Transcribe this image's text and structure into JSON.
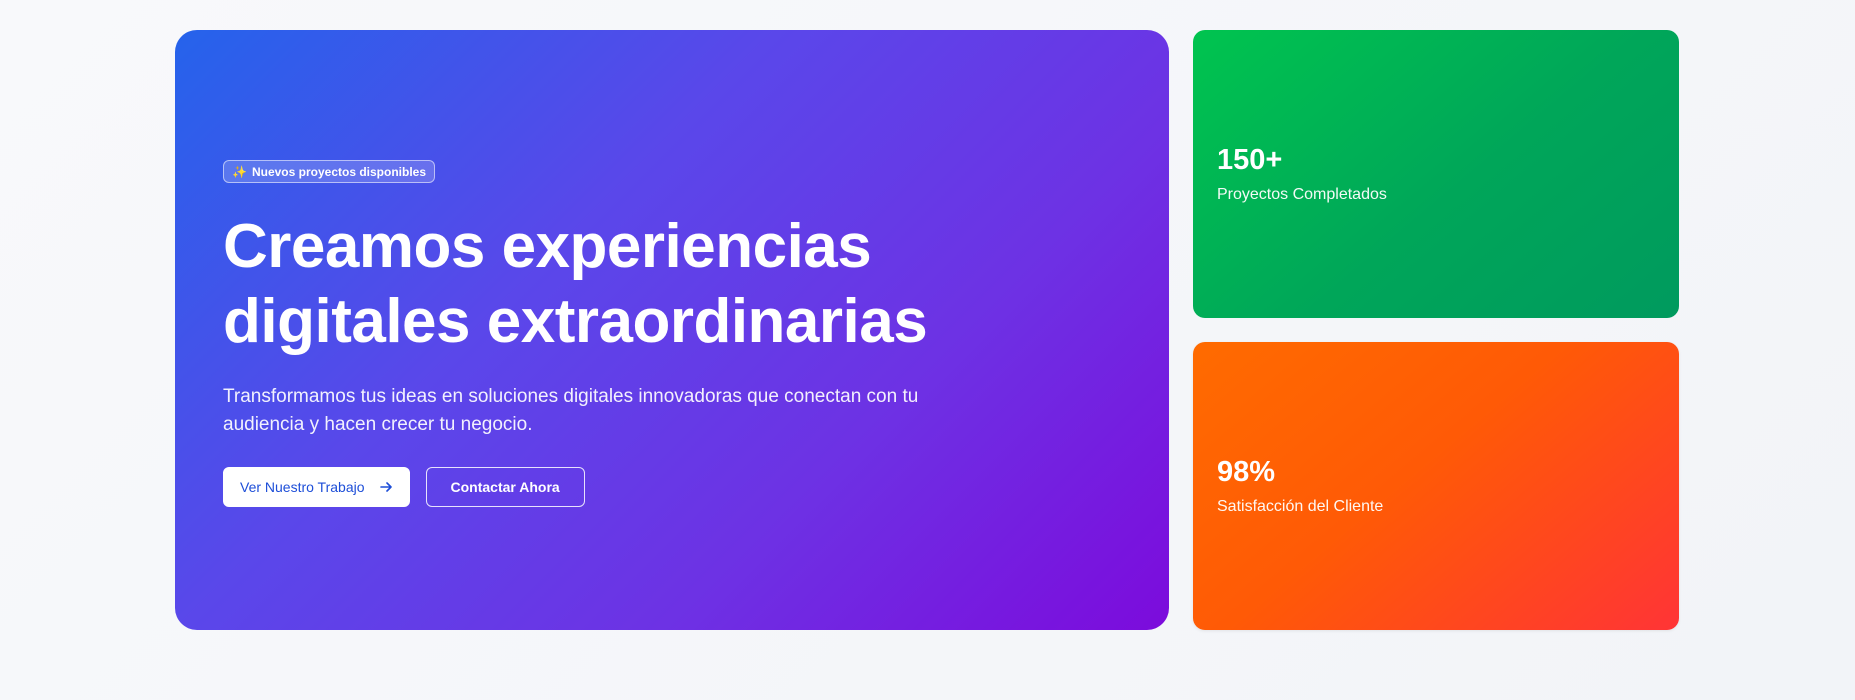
{
  "hero": {
    "badge_icon": "sparkles-icon",
    "badge_icon_glyph": "✨",
    "badge_text": "Nuevos proyectos disponibles",
    "title": "Creamos experiencias digitales extraordinarias",
    "subtitle": "Transformamos tus ideas en soluciones digitales innovadoras que conectan con tu audiencia y hacen crecer tu negocio.",
    "primary_button": {
      "label": "Ver Nuestro Trabajo",
      "icon": "arrow-right-icon"
    },
    "secondary_button": {
      "label": "Contactar Ahora"
    },
    "gradient": [
      "#2563eb",
      "#7c0bdc"
    ]
  },
  "stats": [
    {
      "value": "150+",
      "label": "Proyectos Completados",
      "color": "#00b154"
    },
    {
      "value": "98%",
      "label": "Satisfacción del Cliente",
      "color": "#ff5a06"
    }
  ]
}
